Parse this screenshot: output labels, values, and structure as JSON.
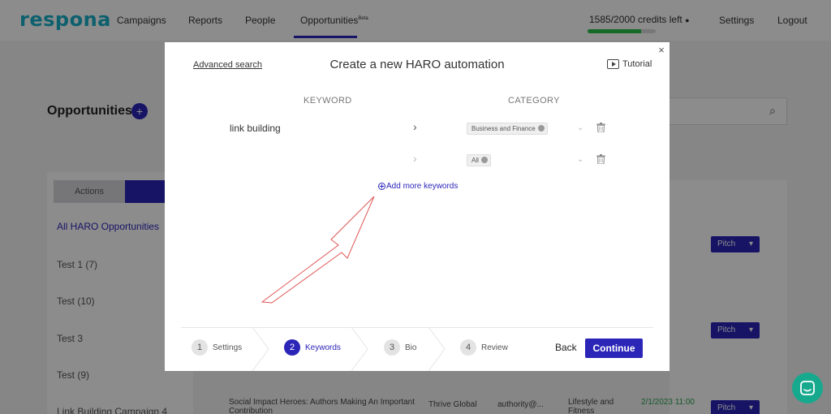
{
  "background": {
    "logo": "respona",
    "nav": [
      "Campaigns",
      "Reports",
      "People",
      "Opportunities"
    ],
    "nav_badge": "Beta",
    "credits_text": "1585/2000 credits left",
    "credits_progress": 0.79,
    "settings": "Settings",
    "logout": "Logout",
    "opportunities_title": "Opportunities",
    "plus": "+",
    "tabs": [
      "Actions"
    ],
    "list_items": [
      "All HARO Opportunities",
      "Test 1 (7)",
      "Test (10)",
      "Test 3",
      "Test (9)",
      "Link Building Campaign 4"
    ],
    "pitch_label": "Pitch",
    "row_text": "Social Impact Heroes: Authors Making An Important Contribution",
    "row_outlet": "Thrive Global",
    "row_email": "authority@...",
    "row_category": "Lifestyle and Fitness",
    "row_date": "2/1/2023 11:00"
  },
  "modal": {
    "advanced_search": "Advanced search",
    "title": "Create a new HARO automation",
    "tutorial": "Tutorial",
    "close": "×",
    "columns": {
      "keyword": "KEYWORD",
      "category": "CATEGORY"
    },
    "rows": [
      {
        "keyword": "link building",
        "category": "Business and Finance"
      },
      {
        "keyword": "",
        "category": "All"
      }
    ],
    "add_more": "Add more keywords",
    "steps": [
      {
        "num": "1",
        "label": "Settings"
      },
      {
        "num": "2",
        "label": "Keywords"
      },
      {
        "num": "3",
        "label": "Bio"
      },
      {
        "num": "4",
        "label": "Review"
      }
    ],
    "active_step": 2,
    "back": "Back",
    "continue": "Continue"
  },
  "colors": {
    "accent": "#2b25b8",
    "teal": "#17a98e",
    "annotation": "#e05555"
  }
}
